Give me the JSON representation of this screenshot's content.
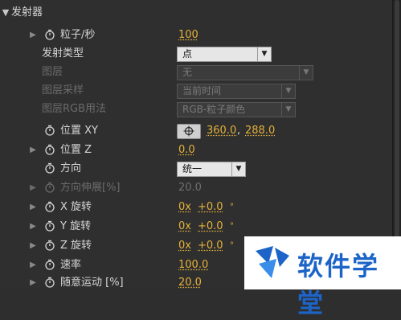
{
  "section": {
    "title": "发射器"
  },
  "rows": {
    "particles_per_sec": {
      "label": "粒子/秒",
      "value": "100"
    },
    "emitter_type": {
      "label": "发射类型",
      "value": "点"
    },
    "layer": {
      "label": "图层",
      "value": "无"
    },
    "layer_sampling": {
      "label": "图层采样",
      "value": "当前时间"
    },
    "layer_rgb": {
      "label": "图层RGB用法",
      "value": "RGB-粒子颜色"
    },
    "position_xy": {
      "label": "位置 XY",
      "x": "360.0",
      "sep": ",",
      "y": "288.0"
    },
    "position_z": {
      "label": "位置 Z",
      "value": "0.0"
    },
    "direction": {
      "label": "方向",
      "value": "统一"
    },
    "direction_spread": {
      "label": "方向伸展[%]",
      "value": "20.0"
    },
    "x_rotation": {
      "label": "X 旋转",
      "turns": "0x",
      "deg": "+0.0",
      "dot": "°"
    },
    "y_rotation": {
      "label": "Y 旋转",
      "turns": "0x",
      "deg": "+0.0",
      "dot": "°"
    },
    "z_rotation": {
      "label": "Z 旋转",
      "turns": "0x",
      "deg": "+0.0",
      "dot": "°"
    },
    "velocity": {
      "label": "速率",
      "value": "100.0"
    },
    "random_motion": {
      "label": "随意运动 [%]",
      "value": "20.0"
    }
  },
  "logo": {
    "text": "软件学堂"
  },
  "colors": {
    "accent": "#e6b23a",
    "panel": "#2f2f2f",
    "logo_blue": "#1d64c8"
  }
}
